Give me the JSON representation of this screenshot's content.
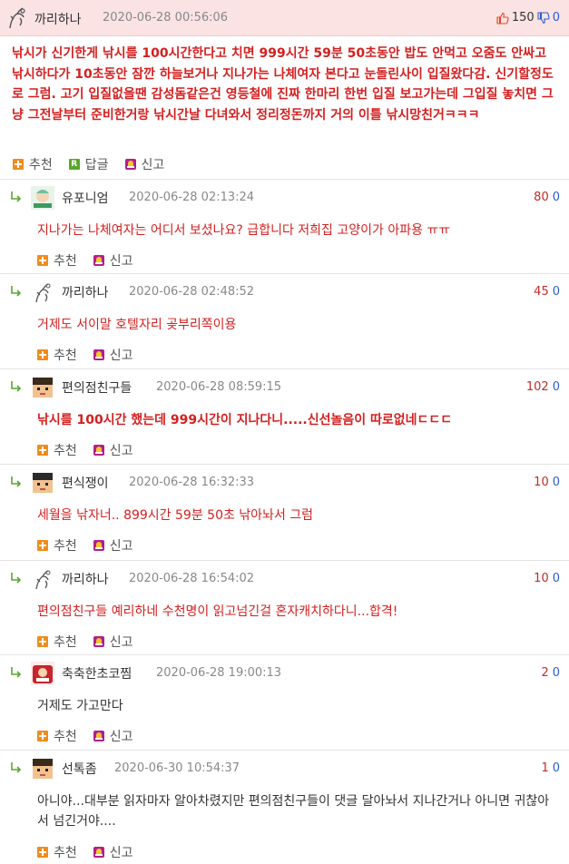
{
  "post": {
    "nickname": "까리하나",
    "date": "2020-06-28 00:56:06",
    "up_count": "150",
    "down_count": "0",
    "body": "낚시가 신기한게 낚시를 100시간한다고 치면 999시간 59분 50초동안 밥도 안먹고 오줌도 안싸고 낚시하다가 10초동안 잠깐 하늘보거나 지나가는 나체여자 본다고 눈돌린사이 입질왔다감. 신기할정도로 그럼. 고기 입질없을땐 감성돔같은건 영등철에 진짜 한마리 한번 입질 보고가는데 그입질 놓치면 그냥 그전날부터 준비한거랑 낚시간날 다녀와서 정리정돈까지 거의 이틀 낚시망친거ㅋㅋㅋ",
    "actions": {
      "recommend": "추천",
      "reply": "답글",
      "report": "신고"
    }
  },
  "comment_actions": {
    "recommend": "추천",
    "report": "신고"
  },
  "comments": [
    {
      "nickname": "유포니엄",
      "date": "2020-06-28 02:13:24",
      "up": "80",
      "down": "0",
      "text": "지나가는 나체여자는 어디서 보셨나요? 급합니다 저희집 고양이가 아파용 ㅠㅠ",
      "color": "#d42020",
      "bold": false
    },
    {
      "nickname": "까리하나",
      "date": "2020-06-28 02:48:52",
      "up": "45",
      "down": "0",
      "text": "거제도 서이말 호텔자리 곶부리쪽이용",
      "color": "#d42020",
      "bold": false
    },
    {
      "nickname": "편의점친구들",
      "date": "2020-06-28 08:59:15",
      "up": "102",
      "down": "0",
      "text": "낚시를 100시간 했는데 999시간이 지나다니.....신선놀음이 따로없네ㄷㄷㄷ",
      "color": "#d42020",
      "bold": true
    },
    {
      "nickname": "편식쟁이",
      "date": "2020-06-28 16:32:33",
      "up": "10",
      "down": "0",
      "text": "세월을 낚자너.. 899시간 59분 50초 낚아놔서 그럼",
      "color": "#d42020",
      "bold": false
    },
    {
      "nickname": "까리하나",
      "date": "2020-06-28 16:54:02",
      "up": "10",
      "down": "0",
      "text": "편의점친구들 예리하네 수천명이 읽고넘긴걸 혼자캐치하다니...합격!",
      "color": "#d42020",
      "bold": false
    },
    {
      "nickname": "축축한초코찜",
      "date": "2020-06-28 19:00:13",
      "up": "2",
      "down": "0",
      "text": "거제도 가고만다",
      "color": "#333333",
      "bold": false
    },
    {
      "nickname": "선톡좀",
      "date": "2020-06-30 10:54:37",
      "up": "1",
      "down": "0",
      "text": "아니야...대부분 읽자마자 알아차렸지만 편의점친구들이 댓글 달아놔서 지나간거나 아니면 귀찮아서 넘긴거야....",
      "color": "#333333",
      "bold": false
    }
  ],
  "colors": {
    "header_bg": "#fbe3e3",
    "accent_red": "#d42020",
    "down_blue": "#2d5bd1",
    "plus_orange": "#f08c1c"
  }
}
